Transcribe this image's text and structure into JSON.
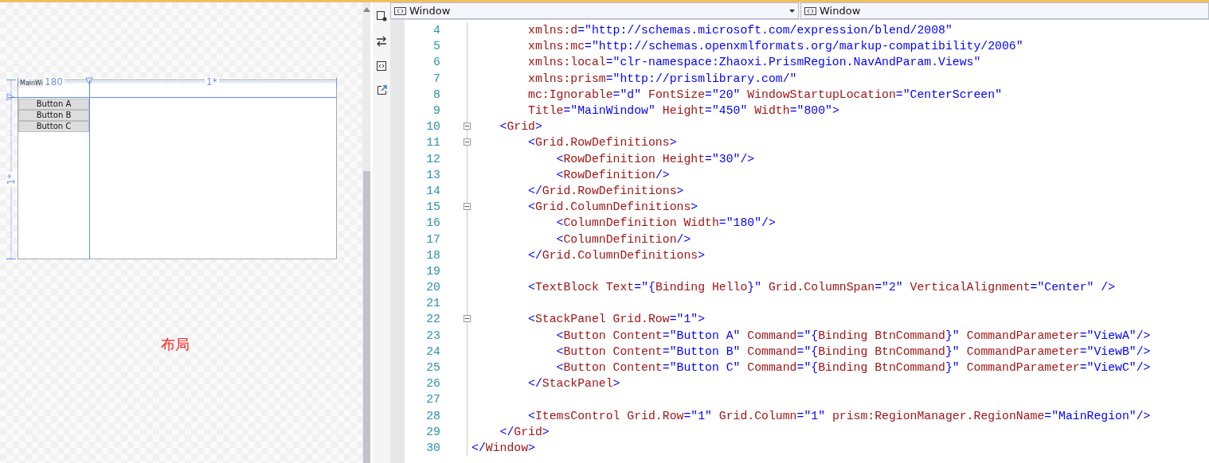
{
  "designer": {
    "window_caption": "MainWi",
    "column_ruler": [
      "180",
      "1*"
    ],
    "row_ruler": "1*",
    "buttons": [
      "Button A",
      "Button B",
      "Button C"
    ],
    "annotation": "布局"
  },
  "editor": {
    "scope_dropdowns": [
      {
        "label": "Window"
      },
      {
        "label": "Window"
      }
    ],
    "lines": [
      {
        "number": "4",
        "fold": false,
        "segments": [
          {
            "kind": "name",
            "text": "        xmlns:d"
          },
          {
            "kind": "value",
            "text": "=\"http://schemas.microsoft.com/expression/blend/2008\""
          }
        ]
      },
      {
        "number": "5",
        "fold": false,
        "segments": [
          {
            "kind": "name",
            "text": "        xmlns:mc"
          },
          {
            "kind": "value",
            "text": "=\"http://schemas.openxmlformats.org/markup-compatibility/2006\""
          }
        ]
      },
      {
        "number": "6",
        "fold": false,
        "segments": [
          {
            "kind": "name",
            "text": "        xmlns:local"
          },
          {
            "kind": "value",
            "text": "=\"clr-namespace:Zhaoxi.PrismRegion.NavAndParam.Views\""
          }
        ]
      },
      {
        "number": "7",
        "fold": false,
        "segments": [
          {
            "kind": "name",
            "text": "        xmlns:prism"
          },
          {
            "kind": "value",
            "text": "=\"http://prismlibrary.com/\""
          }
        ]
      },
      {
        "number": "8",
        "fold": false,
        "segments": [
          {
            "kind": "name",
            "text": "        mc:Ignorable"
          },
          {
            "kind": "value",
            "text": "=\"d\" "
          },
          {
            "kind": "name",
            "text": "FontSize"
          },
          {
            "kind": "value",
            "text": "=\"20\" "
          },
          {
            "kind": "name",
            "text": "WindowStartupLocation"
          },
          {
            "kind": "value",
            "text": "=\"CenterScreen\""
          }
        ]
      },
      {
        "number": "9",
        "fold": false,
        "segments": [
          {
            "kind": "name",
            "text": "        Title"
          },
          {
            "kind": "value",
            "text": "=\"MainWindow\" "
          },
          {
            "kind": "name",
            "text": "Height"
          },
          {
            "kind": "value",
            "text": "=\"450\" "
          },
          {
            "kind": "name",
            "text": "Width"
          },
          {
            "kind": "value",
            "text": "=\"800\">"
          }
        ]
      },
      {
        "number": "10",
        "fold": true,
        "segments": [
          {
            "kind": "value",
            "text": "    <"
          },
          {
            "kind": "name",
            "text": "Grid"
          },
          {
            "kind": "value",
            "text": ">"
          }
        ]
      },
      {
        "number": "11",
        "fold": true,
        "segments": [
          {
            "kind": "value",
            "text": "        <"
          },
          {
            "kind": "name",
            "text": "Grid.RowDefinitions"
          },
          {
            "kind": "value",
            "text": ">"
          }
        ]
      },
      {
        "number": "12",
        "fold": false,
        "segments": [
          {
            "kind": "value",
            "text": "            <"
          },
          {
            "kind": "name",
            "text": "RowDefinition Height"
          },
          {
            "kind": "value",
            "text": "=\"30\"/>"
          }
        ]
      },
      {
        "number": "13",
        "fold": false,
        "segments": [
          {
            "kind": "value",
            "text": "            <"
          },
          {
            "kind": "name",
            "text": "RowDefinition"
          },
          {
            "kind": "value",
            "text": "/>"
          }
        ]
      },
      {
        "number": "14",
        "fold": false,
        "segments": [
          {
            "kind": "value",
            "text": "        </"
          },
          {
            "kind": "name",
            "text": "Grid.RowDefinitions"
          },
          {
            "kind": "value",
            "text": ">"
          }
        ]
      },
      {
        "number": "15",
        "fold": true,
        "segments": [
          {
            "kind": "value",
            "text": "        <"
          },
          {
            "kind": "name",
            "text": "Grid.ColumnDefinitions"
          },
          {
            "kind": "value",
            "text": ">"
          }
        ]
      },
      {
        "number": "16",
        "fold": false,
        "segments": [
          {
            "kind": "value",
            "text": "            <"
          },
          {
            "kind": "name",
            "text": "ColumnDefinition Width"
          },
          {
            "kind": "value",
            "text": "=\"180\"/>"
          }
        ]
      },
      {
        "number": "17",
        "fold": false,
        "segments": [
          {
            "kind": "value",
            "text": "            <"
          },
          {
            "kind": "name",
            "text": "ColumnDefinition"
          },
          {
            "kind": "value",
            "text": "/>"
          }
        ]
      },
      {
        "number": "18",
        "fold": false,
        "segments": [
          {
            "kind": "value",
            "text": "        </"
          },
          {
            "kind": "name",
            "text": "Grid.ColumnDefinitions"
          },
          {
            "kind": "value",
            "text": ">"
          }
        ]
      },
      {
        "number": "19",
        "fold": false
      },
      {
        "number": "20",
        "fold": false,
        "segments": [
          {
            "kind": "value",
            "text": "        <"
          },
          {
            "kind": "name",
            "text": "TextBlock Text"
          },
          {
            "kind": "value",
            "text": "=\"{"
          },
          {
            "kind": "name",
            "text": "Binding Hello"
          },
          {
            "kind": "value",
            "text": "}\" "
          },
          {
            "kind": "name",
            "text": "Grid.ColumnSpan"
          },
          {
            "kind": "value",
            "text": "=\"2\" "
          },
          {
            "kind": "name",
            "text": "VerticalAlignment"
          },
          {
            "kind": "value",
            "text": "=\"Center\" />"
          }
        ]
      },
      {
        "number": "21",
        "fold": false
      },
      {
        "number": "22",
        "fold": true,
        "segments": [
          {
            "kind": "value",
            "text": "        <"
          },
          {
            "kind": "name",
            "text": "StackPanel Grid.Row"
          },
          {
            "kind": "value",
            "text": "=\"1\">"
          }
        ]
      },
      {
        "number": "23",
        "fold": false,
        "segments": [
          {
            "kind": "value",
            "text": "            <"
          },
          {
            "kind": "name",
            "text": "Button Content"
          },
          {
            "kind": "value",
            "text": "=\"Button A\" "
          },
          {
            "kind": "name",
            "text": "Command"
          },
          {
            "kind": "value",
            "text": "=\"{"
          },
          {
            "kind": "name",
            "text": "Binding BtnCommand"
          },
          {
            "kind": "value",
            "text": "}\" "
          },
          {
            "kind": "name",
            "text": "CommandParameter"
          },
          {
            "kind": "value",
            "text": "=\"ViewA\"/>"
          }
        ]
      },
      {
        "number": "24",
        "fold": false,
        "segments": [
          {
            "kind": "value",
            "text": "            <"
          },
          {
            "kind": "name",
            "text": "Button Content"
          },
          {
            "kind": "value",
            "text": "=\"Button B\" "
          },
          {
            "kind": "name",
            "text": "Command"
          },
          {
            "kind": "value",
            "text": "=\"{"
          },
          {
            "kind": "name",
            "text": "Binding BtnCommand"
          },
          {
            "kind": "value",
            "text": "}\" "
          },
          {
            "kind": "name",
            "text": "CommandParameter"
          },
          {
            "kind": "value",
            "text": "=\"ViewB\"/>"
          }
        ]
      },
      {
        "number": "25",
        "fold": false,
        "segments": [
          {
            "kind": "value",
            "text": "            <"
          },
          {
            "kind": "name",
            "text": "Button Content"
          },
          {
            "kind": "value",
            "text": "=\"Button C\" "
          },
          {
            "kind": "name",
            "text": "Command"
          },
          {
            "kind": "value",
            "text": "=\"{"
          },
          {
            "kind": "name",
            "text": "Binding BtnCommand"
          },
          {
            "kind": "value",
            "text": "}\" "
          },
          {
            "kind": "name",
            "text": "CommandParameter"
          },
          {
            "kind": "value",
            "text": "=\"ViewC\"/>"
          }
        ]
      },
      {
        "number": "26",
        "fold": false,
        "segments": [
          {
            "kind": "value",
            "text": "        </"
          },
          {
            "kind": "name",
            "text": "StackPanel"
          },
          {
            "kind": "value",
            "text": ">"
          }
        ]
      },
      {
        "number": "27",
        "fold": false
      },
      {
        "number": "28",
        "fold": false,
        "segments": [
          {
            "kind": "value",
            "text": "        <"
          },
          {
            "kind": "name",
            "text": "ItemsControl Grid.Row"
          },
          {
            "kind": "value",
            "text": "=\"1\" "
          },
          {
            "kind": "name",
            "text": "Grid.Column"
          },
          {
            "kind": "value",
            "text": "=\"1\" "
          },
          {
            "kind": "name",
            "text": "prism:RegionManager.RegionName"
          },
          {
            "kind": "value",
            "text": "=\"MainRegion\"/>"
          }
        ]
      },
      {
        "number": "29",
        "fold": false,
        "segments": [
          {
            "kind": "value",
            "text": "    </"
          },
          {
            "kind": "name",
            "text": "Grid"
          },
          {
            "kind": "value",
            "text": ">"
          }
        ]
      },
      {
        "number": "30",
        "fold": false,
        "segments": [
          {
            "kind": "value",
            "text": "</"
          },
          {
            "kind": "name",
            "text": "Window"
          },
          {
            "kind": "value",
            "text": ">"
          }
        ]
      }
    ]
  }
}
